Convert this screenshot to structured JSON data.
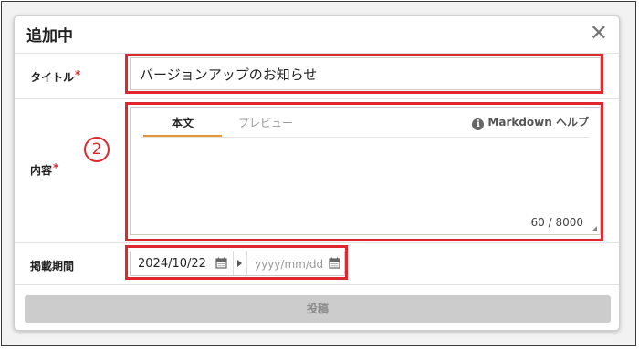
{
  "dialog": {
    "title": "追加中",
    "close_symbol": "✕",
    "fields": {
      "title_label": "タイトル",
      "title_value": "バージョンアップのお知らせ",
      "content_label": "内容",
      "period_label": "掲載期間",
      "required_mark": "*"
    },
    "editor": {
      "tabs": [
        "本文",
        "プレビュー"
      ],
      "active_tab": "本文",
      "markdown_help": "Markdown ヘルプ",
      "info_icon_glyph": "i",
      "char_count": "60 / 8000"
    },
    "date_range": {
      "start": "2024/10/22",
      "end_placeholder": "yyyy/mm/dd"
    },
    "submit_label": "投稿"
  },
  "annotation": {
    "circled_number": "②",
    "color": "#e0262f"
  },
  "icons": [
    "close-icon",
    "info-icon",
    "calendar-icon",
    "arrow-right-icon",
    "resize-grip-icon"
  ],
  "colors": {
    "accent_tab_underline": "#e69438",
    "required_asterisk": "#e0262f",
    "submit_disabled_bg": "#cccccc"
  }
}
